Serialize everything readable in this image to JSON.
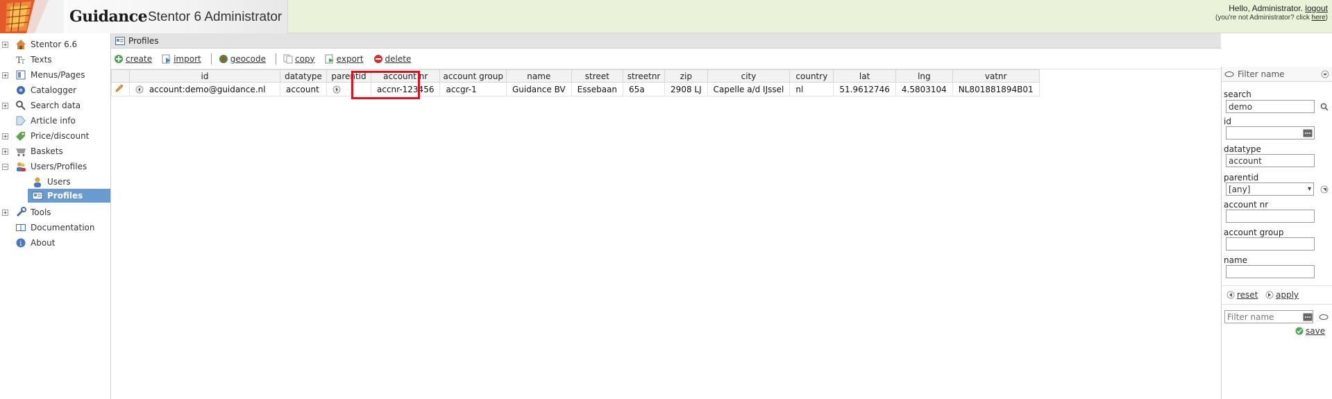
{
  "header": {
    "brand": "Guidance",
    "app_title": "Stentor 6 Administrator",
    "greeting": "Hello, Administrator.",
    "logout_label": "logout",
    "not_user_text": "(you're not Administrator? click",
    "here_label": "here",
    "not_user_close": ")"
  },
  "sidebar": {
    "items": [
      {
        "label": "Stentor 6.6",
        "icon": "home-icon"
      },
      {
        "label": "Texts",
        "icon": "text-icon"
      },
      {
        "label": "Menus/Pages",
        "icon": "pages-icon"
      },
      {
        "label": "Catalogger",
        "icon": "catalog-icon"
      },
      {
        "label": "Search data",
        "icon": "search-icon"
      },
      {
        "label": "Article info",
        "icon": "tag-icon"
      },
      {
        "label": "Price/discount",
        "icon": "price-icon"
      },
      {
        "label": "Baskets",
        "icon": "basket-icon"
      },
      {
        "label": "Users/Profiles",
        "icon": "users-icon"
      },
      {
        "label": "Users",
        "icon": "user-icon"
      },
      {
        "label": "Profiles",
        "icon": "profile-icon"
      },
      {
        "label": "Tools",
        "icon": "wrench-icon"
      },
      {
        "label": "Documentation",
        "icon": "book-icon"
      },
      {
        "label": "About",
        "icon": "info-icon"
      }
    ]
  },
  "panel": {
    "title": "Profiles"
  },
  "toolbar": {
    "create": "create",
    "import": "import",
    "geocode": "geocode",
    "copy": "copy",
    "export": "export",
    "delete": "delete"
  },
  "grid": {
    "columns": [
      "id",
      "datatype",
      "parentid",
      "account nr",
      "account group",
      "name",
      "street",
      "streetnr",
      "zip",
      "city",
      "country",
      "lat",
      "lng",
      "vatnr"
    ],
    "rows": [
      {
        "id": "account:demo@guidance.nl",
        "datatype": "account",
        "parentid": "",
        "account_nr": "accnr-123456",
        "account_group": "accgr-1",
        "name": "Guidance BV",
        "street": "Essebaan",
        "streetnr": "65a",
        "zip": "2908 LJ",
        "city": "Capelle a/d IJssel",
        "country": "nl",
        "lat": "51.9612746",
        "lng": "4.5803104",
        "vatnr": "NL801881894B01"
      }
    ]
  },
  "filter": {
    "header_placeholder": "Filter name",
    "search_label": "search",
    "search_value": "demo",
    "id_label": "id",
    "id_value": "",
    "datatype_label": "datatype",
    "datatype_value": "account",
    "parentid_label": "parentid",
    "parentid_value": "[any]",
    "account_nr_label": "account nr",
    "account_group_label": "account group",
    "name_label": "name",
    "reset_label": "reset",
    "apply_label": "apply",
    "save_placeholder": "Filter name",
    "save_label": "save"
  },
  "colors": {
    "header_bg": "#eaf3da",
    "selected_nav": "#6a9bd0",
    "highlight": "#e01020"
  }
}
